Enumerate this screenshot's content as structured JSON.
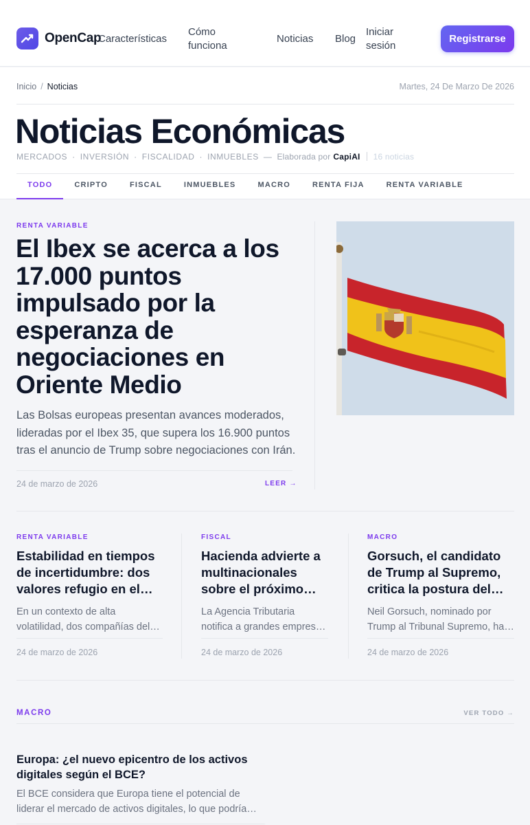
{
  "header": {
    "brand": "OpenCap",
    "nav": {
      "features": "Características",
      "how": "Cómo funciona",
      "news": "Noticias",
      "blog": "Blog",
      "login": "Iniciar sesión"
    },
    "cta": "Registrarse"
  },
  "breadcrumb": {
    "home": "Inicio",
    "separator": "/",
    "current": "Noticias"
  },
  "date_top": "Martes, 24 De Marzo De 2026",
  "page": {
    "title": "Noticias Económicas",
    "categories": [
      "MERCADOS",
      "INVERSIÓN",
      "FISCALIDAD",
      "INMUEBLES"
    ],
    "dot": "·",
    "dash": "—",
    "by_label": "Elaborada por",
    "author": "CapiAI",
    "count": "16 noticias"
  },
  "tabs": [
    "TODO",
    "CRIPTO",
    "FISCAL",
    "INMUEBLES",
    "MACRO",
    "RENTA FIJA",
    "RENTA VARIABLE"
  ],
  "featured": {
    "kicker": "RENTA VARIABLE",
    "title": "El Ibex se acerca a los 17.000 puntos impulsado por la esperanza de negociaciones en Oriente Medio",
    "summary": "Las Bolsas europeas presentan avances moderados, lideradas por el Ibex 35, que supera los 16.900 puntos tras el anuncio de Trump sobre negociaciones con Irán.",
    "date": "24 de marzo de 2026",
    "read": "LEER →",
    "image_icon": "spanish-flag-photo"
  },
  "cards": [
    {
      "kicker": "RENTA VARIABLE",
      "title": "Estabilidad en tiempos de incertidumbre: dos valores refugio en el mercado",
      "summary": "En un contexto de alta volatilidad, dos compañías del mercado destacan como refugio.",
      "date": "24 de marzo de 2026"
    },
    {
      "kicker": "FISCAL",
      "title": "Hacienda advierte a multinacionales sobre el próximo cambio fiscal",
      "summary": "La Agencia Tributaria notifica a grandes empresas los nuevos requisitos.",
      "date": "24 de marzo de 2026"
    },
    {
      "kicker": "MACRO",
      "title": "Gorsuch, el candidato de Trump al Supremo, critica la postura del gobierno",
      "summary": "Neil Gorsuch, nominado por Trump al Tribunal Supremo, ha criticado la postura oficial.",
      "date": "24 de marzo de 2026"
    }
  ],
  "section": {
    "label": "MACRO",
    "view_all": "VER TODO →",
    "item": {
      "title": "Europa: ¿el nuevo epicentro de los activos digitales según el BCE?",
      "summary": "El BCE considera que Europa tiene el potencial de liderar el mercado de activos digitales, lo que podría transformar el sector."
    }
  },
  "colors": {
    "accent": "#7c3aed",
    "cta": "#6366f1",
    "text": "#0f172a",
    "muted": "#6b7280"
  }
}
